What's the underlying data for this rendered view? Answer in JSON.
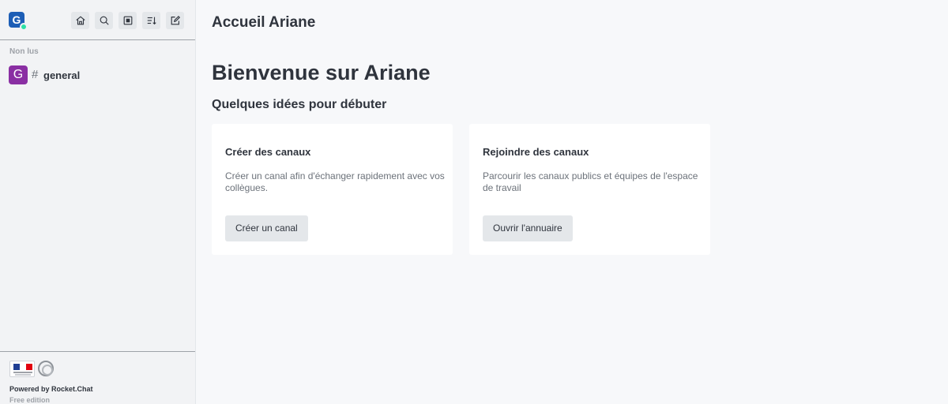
{
  "sidebar": {
    "user_initial": "G",
    "toolbar": {
      "home": "home-icon",
      "search": "search-icon",
      "directory": "directory-icon",
      "sort": "sort-icon",
      "create": "edit-icon"
    },
    "section_label": "Non lus",
    "rooms": [
      {
        "initial": "G",
        "name": "general",
        "icon": "hash-icon"
      }
    ],
    "footer": {
      "powered": "Powered by Rocket.Chat",
      "edition": "Free edition"
    }
  },
  "main": {
    "page_title": "Accueil Ariane",
    "welcome": "Bienvenue sur Ariane",
    "subtitle": "Quelques idées pour débuter",
    "cards": [
      {
        "title": "Créer des canaux",
        "text": "Créer un canal afin d'échanger rapidement avec vos collègues.",
        "button": "Créer un canal"
      },
      {
        "title": "Rejoindre des canaux",
        "text": "Parcourir les canaux publics et équipes de l'espace de travail",
        "button": "Ouvrir l'annuaire"
      }
    ]
  },
  "colors": {
    "user_avatar": "#1d5eb6",
    "status_online": "#2de0a5",
    "room_avatar": "#8a2fa3",
    "background": "#f7f8fa",
    "sidebar": "#f2f3f5"
  }
}
